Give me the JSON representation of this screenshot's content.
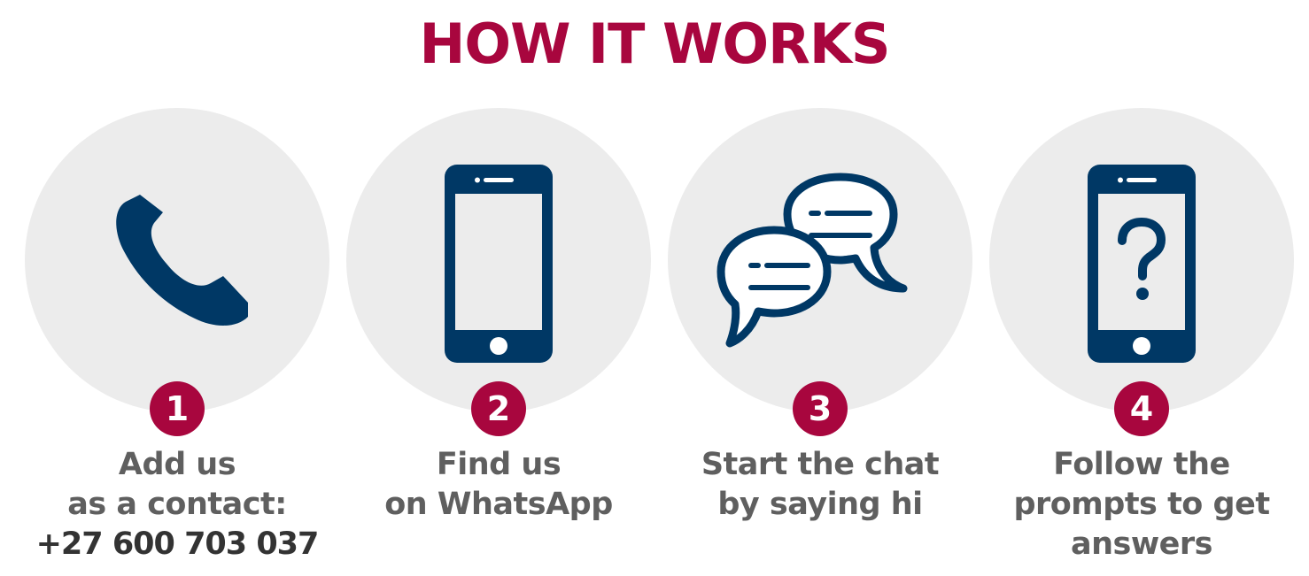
{
  "title": "HOW IT WORKS",
  "colors": {
    "accent": "#a8063e",
    "icon": "#003865",
    "circle": "#ececec",
    "text": "#5f5f5f"
  },
  "steps": [
    {
      "number": "1",
      "icon": "phone-handset-icon",
      "lines": [
        "Add us",
        "as a contact:"
      ],
      "phone": "+27 600 703 037"
    },
    {
      "number": "2",
      "icon": "smartphone-icon",
      "lines": [
        "Find us",
        "on WhatsApp"
      ]
    },
    {
      "number": "3",
      "icon": "chat-bubbles-icon",
      "lines": [
        "Start the chat",
        "by saying hi"
      ]
    },
    {
      "number": "4",
      "icon": "smartphone-question-icon",
      "lines": [
        "Follow the",
        "prompts to get",
        "answers"
      ]
    }
  ]
}
